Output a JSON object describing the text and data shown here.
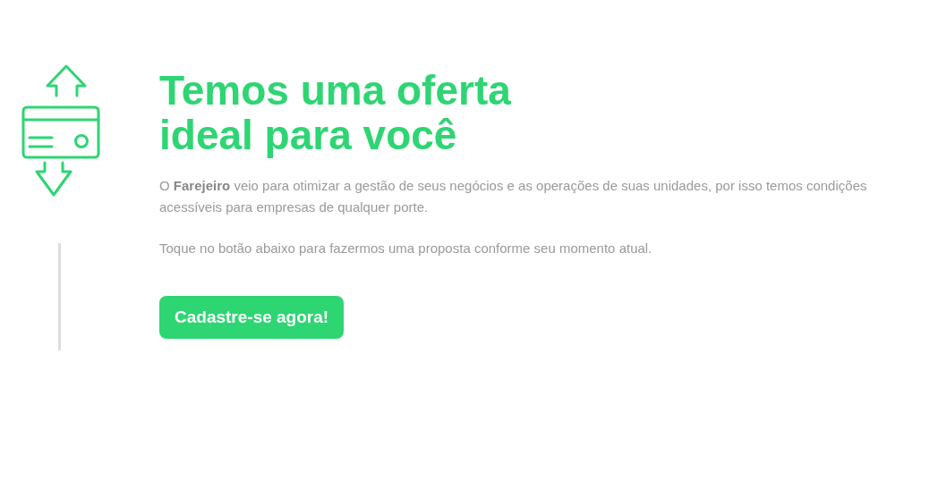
{
  "heading": {
    "lines": [
      "Temos uma oferta",
      "ideal para você"
    ]
  },
  "paragraphs": [
    "O **Farejeiro** veio para otimizar a gestão de seus negócios e as operações de suas unidades, por isso temos condições acessíveis para empresas de qualquer porte.",
    "Toque no botão abaixo para fazermos uma proposta conforme seu momento atual."
  ],
  "button": {
    "label": "Cadastre-se agora!"
  }
}
